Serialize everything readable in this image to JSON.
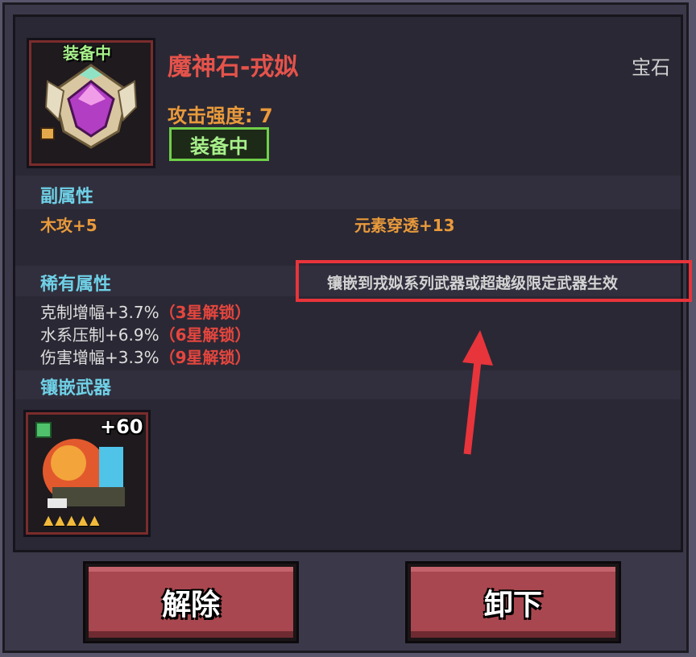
{
  "item": {
    "equipped_tag": "装备中",
    "name": "魔神石-戎姒",
    "type": "宝石",
    "attack": "攻击强度: 7",
    "equipped_badge": "装备中"
  },
  "sub_attributes": {
    "title": "副属性",
    "left": "木攻+5",
    "right": "元素穿透+13"
  },
  "rare_attributes": {
    "title": "稀有属性",
    "note": "镶嵌到戎姒系列武器或超越级限定武器生效",
    "lines": [
      {
        "stat": "克制增幅+3.7%",
        "unlock": "（3星解锁）"
      },
      {
        "stat": "水系压制+6.9%",
        "unlock": "（6星解锁）"
      },
      {
        "stat": "伤害增幅+3.3%",
        "unlock": "（9星解锁）"
      }
    ]
  },
  "inlay_weapon": {
    "title": "镶嵌武器",
    "level": "+60",
    "stars": "▲▲▲▲▲"
  },
  "buttons": {
    "release": "解除",
    "unequip": "卸下"
  },
  "colors": {
    "highlight": "#e8343b",
    "button": "#a8474f",
    "section_title": "#6fd0e6",
    "item_name": "#e5534b",
    "attribute": "#e99a3b"
  }
}
